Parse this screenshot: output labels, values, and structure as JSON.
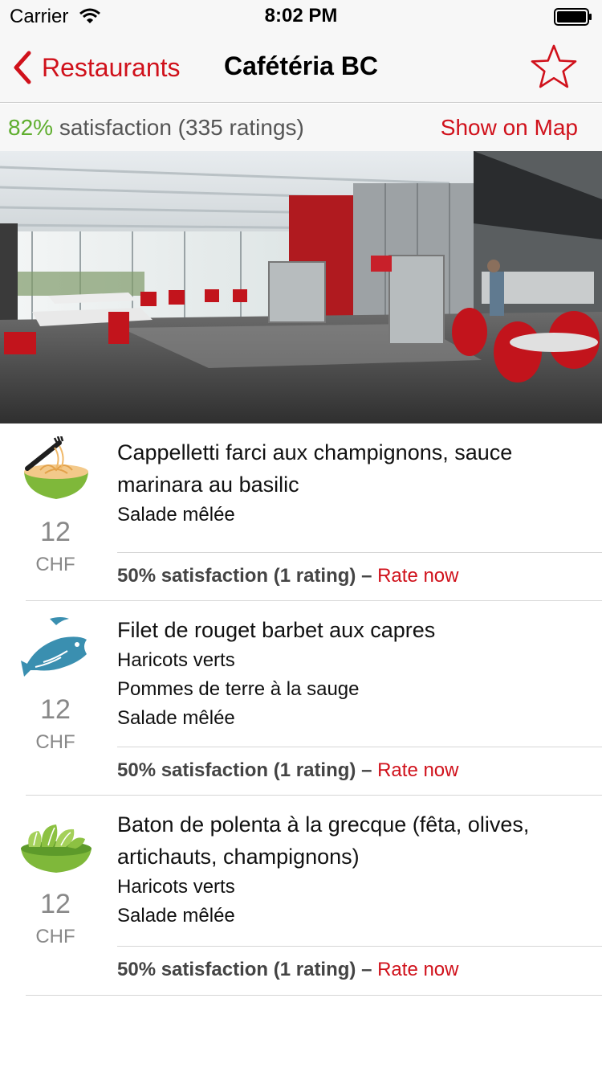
{
  "status_bar": {
    "carrier": "Carrier",
    "time": "8:02 PM"
  },
  "nav": {
    "back_label": "Restaurants",
    "title": "Cafétéria BC"
  },
  "summary": {
    "percent": "82%",
    "text": " satisfaction (335 ratings)",
    "map_link": "Show on Map"
  },
  "colors": {
    "accent_red": "#d0111b",
    "satisfaction_green": "#5fae2e"
  },
  "menu": [
    {
      "icon": "pasta-bowl-icon",
      "title": "Cappelletti farci aux champignons, sauce marinara au basilic",
      "sides": [
        "Salade mêlée"
      ],
      "price": "12",
      "currency": "CHF",
      "rating_text": "50% satisfaction (1 rating) – ",
      "rate_label": "Rate now"
    },
    {
      "icon": "fish-icon",
      "title": "Filet de rouget barbet aux capres",
      "sides": [
        "Haricots verts",
        "Pommes de terre à la sauge",
        "Salade mêlée"
      ],
      "price": "12",
      "currency": "CHF",
      "rating_text": "50% satisfaction (1 rating) – ",
      "rate_label": "Rate now"
    },
    {
      "icon": "salad-bowl-icon",
      "title": "Baton de polenta à la grecque (fêta, olives, artichauts, champignons)",
      "sides": [
        "Haricots verts",
        "Salade mêlée"
      ],
      "price": "12",
      "currency": "CHF",
      "rating_text": "50% satisfaction (1 rating) – ",
      "rate_label": "Rate now"
    }
  ]
}
